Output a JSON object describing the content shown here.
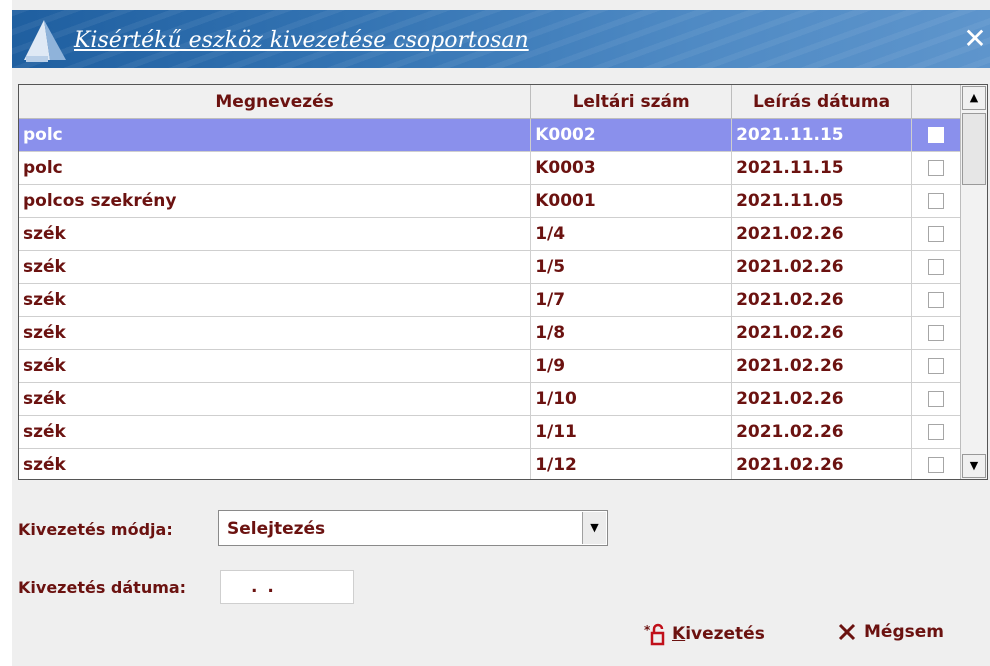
{
  "window": {
    "title": "Kisértékű eszköz kivezetése csoportosan"
  },
  "table": {
    "columns": [
      "Megnevezés",
      "Leltári szám",
      "Leírás dátuma",
      ""
    ],
    "rows": [
      {
        "name": "polc",
        "inv": "K0002",
        "date": "2021.11.15",
        "checked": false
      },
      {
        "name": "polc",
        "inv": "K0003",
        "date": "2021.11.15",
        "checked": false
      },
      {
        "name": "polcos szekrény",
        "inv": "K0001",
        "date": "2021.11.05",
        "checked": false
      },
      {
        "name": "szék",
        "inv": "1/4",
        "date": "2021.02.26",
        "checked": false
      },
      {
        "name": "szék",
        "inv": "1/5",
        "date": "2021.02.26",
        "checked": false
      },
      {
        "name": "szék",
        "inv": "1/7",
        "date": "2021.02.26",
        "checked": false
      },
      {
        "name": "szék",
        "inv": "1/8",
        "date": "2021.02.26",
        "checked": false
      },
      {
        "name": "szék",
        "inv": "1/9",
        "date": "2021.02.26",
        "checked": false
      },
      {
        "name": "szék",
        "inv": "1/10",
        "date": "2021.02.26",
        "checked": false
      },
      {
        "name": "szék",
        "inv": "1/11",
        "date": "2021.02.26",
        "checked": false
      },
      {
        "name": "szék",
        "inv": "1/12",
        "date": "2021.02.26",
        "checked": false
      }
    ]
  },
  "form": {
    "mode_label": "Kivezetés módja:",
    "mode_value": "Selejtezés",
    "date_label": "Kivezetés dátuma:",
    "date_value": ". ."
  },
  "buttons": {
    "kivezetes_accel": "K",
    "kivezetes_rest": "ivezetés",
    "cancel": "Mégsem"
  },
  "colors": {
    "text": "#6b1210",
    "selection": "#8a90ec",
    "titlebar": "#3474b3"
  },
  "icons": {
    "logo": "app-logo-icon",
    "close": "close-icon",
    "kivezetes": "unlock-export-icon",
    "cancel": "x-icon",
    "scroll_up": "arrow-up-icon",
    "scroll_down": "arrow-down-icon",
    "dropdown": "arrow-down-icon"
  }
}
